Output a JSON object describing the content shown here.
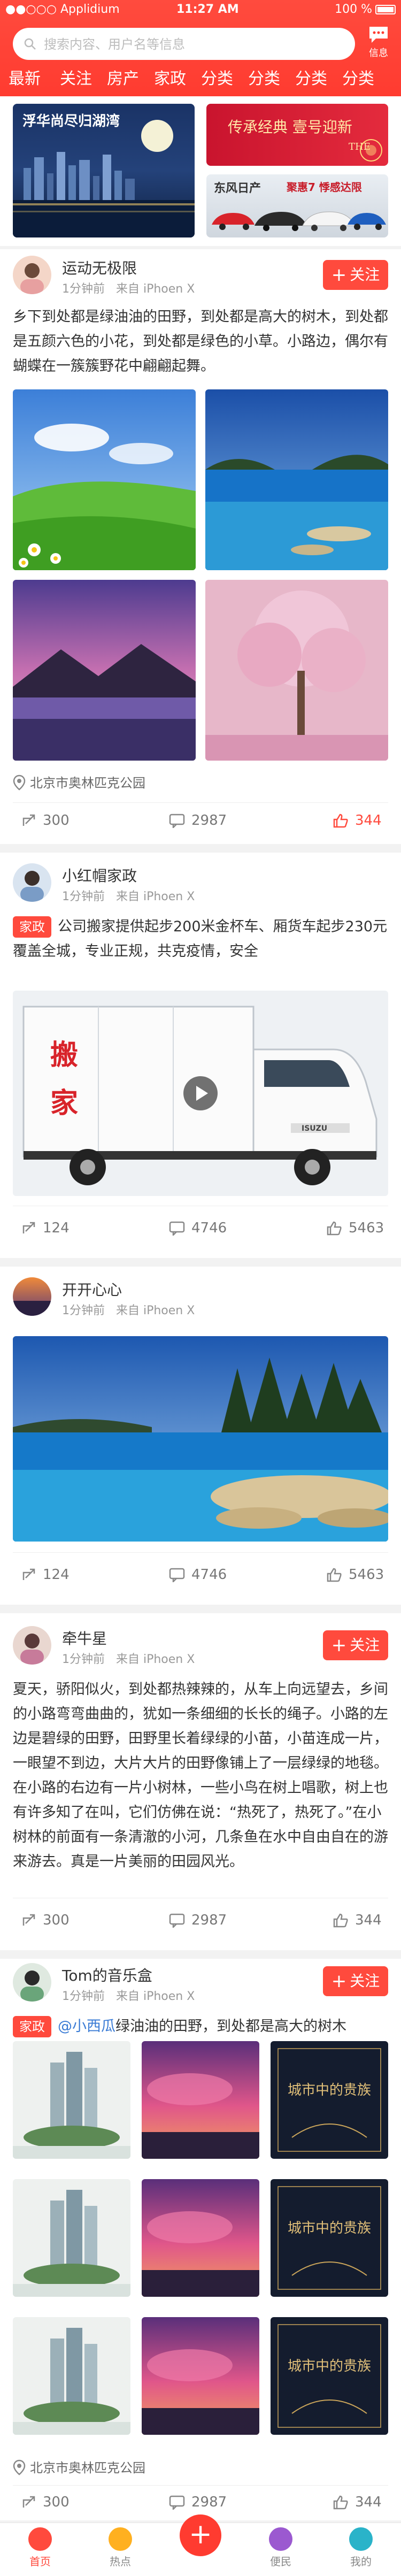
{
  "status_bar": {
    "carrier": "●●○○○ Applidium",
    "time": "11:27 AM",
    "battery": "100 %"
  },
  "search": {
    "placeholder": "搜索内容、用户名等信息"
  },
  "message_button": {
    "label": "信息"
  },
  "category_tabs": [
    "最新",
    "关注",
    "房产",
    "家政",
    "分类",
    "分类",
    "分类",
    "分类"
  ],
  "banners": [
    {
      "title": "浮华尚尽归湖湾"
    },
    {
      "title": "传承经典 壹号迎新",
      "sub": "THE"
    },
    {
      "title": "东风日产",
      "sub": "聚惠7 悸感达限"
    }
  ],
  "posts": [
    {
      "username": "运动无极限",
      "time": "1分钟前",
      "source": "来自 iPhoen X",
      "follow_label": "关注",
      "text": "乡下到处都是绿油油的田野，到处都是高大的树木，到处都是五颜六色的小花，到处都是绿色的小草。小路边，偶尔有蝴蝶在一簇簇野花中翩翩起舞。",
      "images": [
        "meadow-photo",
        "lake-photo",
        "mountain-lake-photo",
        "blossom-tree-photo"
      ],
      "location": "北京市奥林匹克公园",
      "shares": "300",
      "comments": "2987",
      "likes": "344"
    },
    {
      "username": "小红帽家政",
      "time": "1分钟前",
      "source": "来自 iPhoen X",
      "tag": "家政",
      "text": "公司搬家提供起步200米金杯车、厢货车起步230元覆盖全城，专业正规，共克疫情，安全",
      "truck_text": "搬 家",
      "truck_brand": "ISUZU",
      "shares": "124",
      "comments": "4746",
      "likes": "5463"
    },
    {
      "username": "开开心心",
      "time": "1分钟前",
      "source": "来自 iPhoen X",
      "shares": "124",
      "comments": "4746",
      "likes": "5463"
    },
    {
      "username": "牵牛星",
      "time": "1分钟前",
      "source": "来自 iPhoen X",
      "follow_label": "关注",
      "text": "夏天，骄阳似火，到处都热辣辣的，从车上向远望去，乡间的小路弯弯曲曲的，犹如一条细细的长长的绳子。小路的左边是碧绿的田野，田野里长着绿绿的小苗，小苗连成一片，一眼望不到边，大片大片的田野像铺上了一层绿绿的地毯。在小路的右边有一片小树林，一些小鸟在树上唱歌，树上也有许多知了在叫，它们仿佛在说：“热死了，热死了。”在小树林的前面有一条清澈的小河，几条鱼在水中自由自在的游来游去。真是一片美丽的田园风光。",
      "shares": "300",
      "comments": "2987",
      "likes": "344"
    },
    {
      "username": "Tom的音乐盒",
      "time": "1分钟前",
      "source": "来自 iPhoen X",
      "follow_label": "关注",
      "tag": "家政",
      "mention": "@小西瓜",
      "text": "绿油油的田野，到处都是高大的树木",
      "poster_text": "城市中的贵族",
      "location": "北京市奥林匹克公园",
      "shares": "300",
      "comments": "2987",
      "likes": "344"
    }
  ],
  "bottom_nav": [
    "首页",
    "热点",
    "",
    "便民",
    "我的"
  ],
  "colors": {
    "accent": "#ff4a3d",
    "header": "#ff3b30",
    "mention": "#3a7bd5"
  }
}
